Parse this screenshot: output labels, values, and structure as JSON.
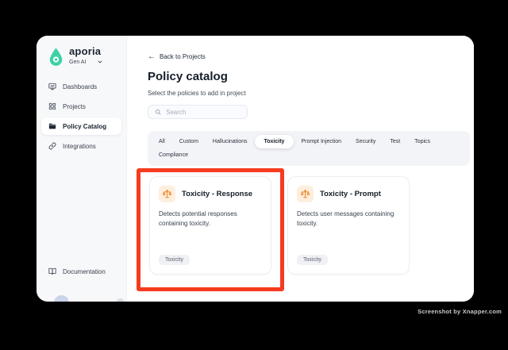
{
  "sidebar": {
    "logo": {
      "brand": "aporia",
      "workspace": "Gen AI"
    },
    "items": [
      {
        "label": "Dashboards",
        "icon": "monitor-icon",
        "active": false
      },
      {
        "label": "Projects",
        "icon": "grid-icon",
        "active": false
      },
      {
        "label": "Policy Catalog",
        "icon": "folder-icon",
        "active": true
      },
      {
        "label": "Integrations",
        "icon": "link-icon",
        "active": false
      }
    ],
    "footer_item": {
      "label": "Documentation",
      "icon": "book-open-icon"
    }
  },
  "main": {
    "back_link": {
      "glyph": "←",
      "label": "Back to Projects"
    },
    "title": "Policy catalog",
    "subtitle": "Select the policies to add in project",
    "search": {
      "placeholder": "Search",
      "icon": "search-icon"
    },
    "tabs": [
      "All",
      "Custom",
      "Hallucinations",
      "Toxicity",
      "Prompt Injection",
      "Security",
      "Test",
      "Topics",
      "Compliance"
    ],
    "active_tab": "Toxicity",
    "cards": [
      {
        "title": "Toxicity - Response",
        "description": "Detects potential responses containing toxicity.",
        "tag": "Toxicity",
        "icon": "scales-icon"
      },
      {
        "title": "Toxicity - Prompt",
        "description": "Detects user messages containing toxicity.",
        "tag": "Toxicity",
        "icon": "scales-icon"
      }
    ]
  },
  "annotation": {
    "type": "highlight-rectangle",
    "color": "#f63b1f",
    "target": "Toxicity - Response card"
  },
  "watermark": "Screenshot by Xnapper.com",
  "colors": {
    "background": "#000000",
    "window": "#ffffff",
    "sidebar_bg": "#f7f8fa",
    "tabs_bg": "#f3f4f8",
    "brand_teal": "#3ed1a5",
    "icon_orange": "#ef7d17",
    "icon_orange_bg": "#fdeedd",
    "badge_bg": "#f0f1f5",
    "annotation_red": "#f63b1f"
  }
}
